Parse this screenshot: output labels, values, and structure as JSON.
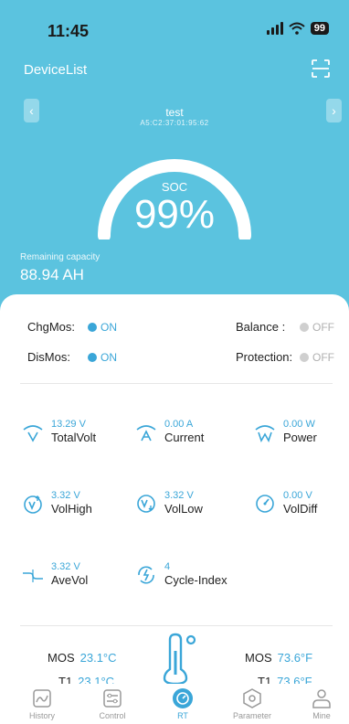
{
  "status_bar": {
    "time": "11:45",
    "battery": "99"
  },
  "header": {
    "device_list_label": "DeviceList",
    "device_name": "test",
    "device_mac": "A5:C2:37:01:95:62",
    "soc_label": "SOC",
    "soc_value": "99%",
    "soc_percent": 99,
    "remaining_label": "Remaining capacity",
    "remaining_value": "88.94 AH"
  },
  "switches": {
    "chg_label": "ChgMos:",
    "chg_state": "ON",
    "dis_label": "DisMos:",
    "dis_state": "ON",
    "balance_label": "Balance :",
    "balance_state": "OFF",
    "protection_label": "Protection:",
    "protection_state": "OFF"
  },
  "metrics": [
    {
      "value": "13.29 V",
      "name": "TotalVolt",
      "icon": "totalvolt-icon"
    },
    {
      "value": "0.00 A",
      "name": "Current",
      "icon": "current-icon"
    },
    {
      "value": "0.00 W",
      "name": "Power",
      "icon": "power-icon"
    },
    {
      "value": "3.32 V",
      "name": "VolHigh",
      "icon": "volhigh-icon"
    },
    {
      "value": "3.32 V",
      "name": "VolLow",
      "icon": "vollow-icon"
    },
    {
      "value": "0.00 V",
      "name": "VolDiff",
      "icon": "voldiff-icon"
    },
    {
      "value": "3.32 V",
      "name": "AveVol",
      "icon": "avevol-icon"
    },
    {
      "value": "4",
      "name": "Cycle-Index",
      "icon": "cycle-index-icon"
    }
  ],
  "temps": {
    "left": [
      {
        "label": "MOS",
        "value": "23.1°C"
      },
      {
        "label": "T1",
        "value": "23.1°C"
      }
    ],
    "right": [
      {
        "label": "MOS",
        "value": "73.6°F"
      },
      {
        "label": "T1",
        "value": "73.6°F"
      }
    ]
  },
  "tabs": [
    {
      "label": "History",
      "icon": "history-icon"
    },
    {
      "label": "Control",
      "icon": "control-icon"
    },
    {
      "label": "RT",
      "icon": "rt-icon",
      "active": true
    },
    {
      "label": "Parameter",
      "icon": "parameter-icon"
    },
    {
      "label": "Mine",
      "icon": "mine-icon"
    }
  ],
  "colors": {
    "header_bg": "#5bc3df",
    "accent": "#3aa6d8",
    "off": "#b0b0b0"
  }
}
